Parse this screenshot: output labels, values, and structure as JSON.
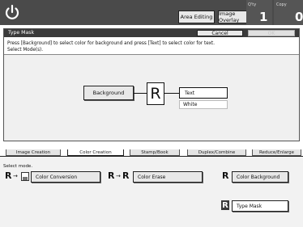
{
  "topbar": {
    "area_editing_label": "Area Editing",
    "image_overlay_label": "Image Overlay",
    "qty_label": "Q'ty",
    "qty_value": "1",
    "copy_label": "Copy",
    "copy_value": "0"
  },
  "dialog": {
    "title": "Type Mask",
    "cancel_label": "Cancel",
    "ok_label": "OK",
    "instruction_line1": "Press [Background] to select color for background and press [Text] to select color for text.",
    "instruction_line2": "Select Mode(s).",
    "background_label": "Background",
    "preview_glyph": "R",
    "text_label": "Text",
    "text_color_value": "White"
  },
  "tabs": [
    {
      "label": "Image Creation"
    },
    {
      "label": "Color Creation"
    },
    {
      "label": "Stamp/Book"
    },
    {
      "label": "Duplex/Combine"
    },
    {
      "label": "Reduce/Enlarge"
    }
  ],
  "panel": {
    "select_mode_label": "Select mode.",
    "modes": [
      {
        "label": "Color Conversion"
      },
      {
        "label": "Color Erase"
      },
      {
        "label": "Color Background"
      },
      {
        "label": "Type Mask"
      }
    ],
    "glyph_r": "R",
    "arrow": "→"
  },
  "colors": {
    "topbar": "#4a4a4a",
    "titlebar": "#3a3a3a",
    "panel": "#f2f2f2"
  }
}
